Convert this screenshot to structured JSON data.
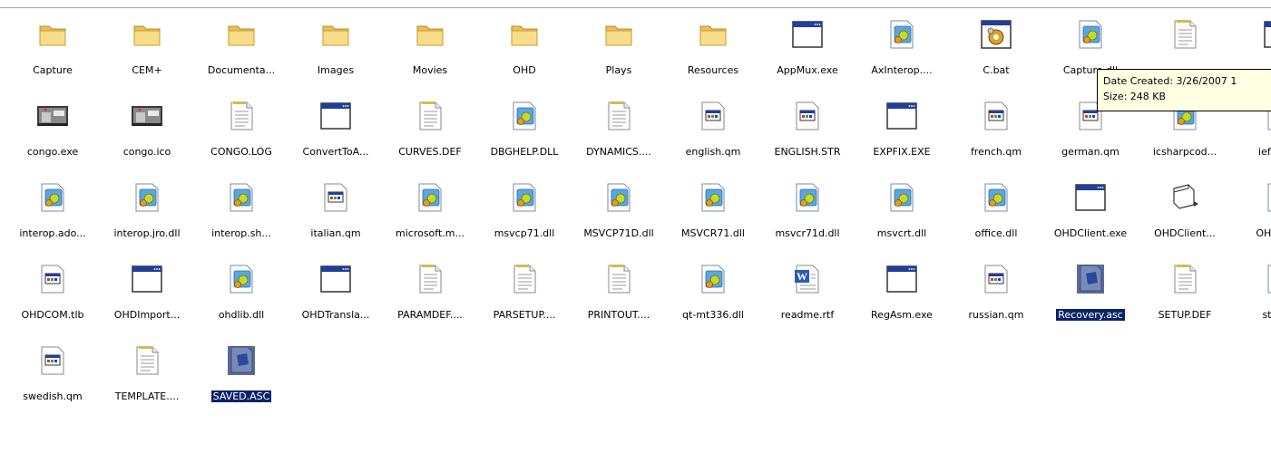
{
  "files": [
    {
      "label": "Capture",
      "icon": "folder"
    },
    {
      "label": "CEM+",
      "icon": "folder"
    },
    {
      "label": "Documenta...",
      "icon": "folder"
    },
    {
      "label": "Images",
      "icon": "folder"
    },
    {
      "label": "Movies",
      "icon": "folder"
    },
    {
      "label": "OHD",
      "icon": "folder"
    },
    {
      "label": "Plays",
      "icon": "folder"
    },
    {
      "label": "Resources",
      "icon": "folder"
    },
    {
      "label": "AppMux.exe",
      "icon": "exe"
    },
    {
      "label": "AxInterop....",
      "icon": "dll"
    },
    {
      "label": "C.bat",
      "icon": "bat"
    },
    {
      "label": "Capture.dll",
      "icon": "dll"
    },
    {
      "label": "",
      "icon": "text"
    },
    {
      "label": "",
      "icon": "exe"
    },
    {
      "label": "congo.exe",
      "icon": "photo"
    },
    {
      "label": "congo.ico",
      "icon": "photo"
    },
    {
      "label": "CONGO.LOG",
      "icon": "text"
    },
    {
      "label": "ConvertToA...",
      "icon": "exe"
    },
    {
      "label": "CURVES.DEF",
      "icon": "text"
    },
    {
      "label": "DBGHELP.DLL",
      "icon": "dll"
    },
    {
      "label": "DYNAMICS....",
      "icon": "text"
    },
    {
      "label": "english.qm",
      "icon": "qm"
    },
    {
      "label": "ENGLISH.STR",
      "icon": "qm"
    },
    {
      "label": "EXPFIX.EXE",
      "icon": "exe"
    },
    {
      "label": "french.qm",
      "icon": "qm"
    },
    {
      "label": "german.qm",
      "icon": "qm"
    },
    {
      "label": "icsharpcod...",
      "icon": "dll"
    },
    {
      "label": "ieframe.",
      "icon": "dll"
    },
    {
      "label": "interop.ado...",
      "icon": "dll"
    },
    {
      "label": "interop.jro.dll",
      "icon": "dll"
    },
    {
      "label": "interop.sh...",
      "icon": "dll"
    },
    {
      "label": "italian.qm",
      "icon": "qm"
    },
    {
      "label": "microsoft.m...",
      "icon": "dll"
    },
    {
      "label": "msvcp71.dll",
      "icon": "dll"
    },
    {
      "label": "MSVCP71D.dll",
      "icon": "dll"
    },
    {
      "label": "MSVCR71.dll",
      "icon": "dll"
    },
    {
      "label": "msvcr71d.dll",
      "icon": "dll"
    },
    {
      "label": "msvcrt.dll",
      "icon": "dll"
    },
    {
      "label": "office.dll",
      "icon": "dll"
    },
    {
      "label": "OHDClient.exe",
      "icon": "exe"
    },
    {
      "label": "OHDClient...",
      "icon": "config"
    },
    {
      "label": "OHDCOM",
      "icon": "dll"
    },
    {
      "label": "OHDCOM.tlb",
      "icon": "qm"
    },
    {
      "label": "OHDImport...",
      "icon": "exe"
    },
    {
      "label": "ohdlib.dll",
      "icon": "dll"
    },
    {
      "label": "OHDTransla...",
      "icon": "exe"
    },
    {
      "label": "PARAMDEF....",
      "icon": "text"
    },
    {
      "label": "PARSETUP....",
      "icon": "text"
    },
    {
      "label": "PRINTOUT....",
      "icon": "text"
    },
    {
      "label": "qt-mt336.dll",
      "icon": "dll"
    },
    {
      "label": "readme.rtf",
      "icon": "word"
    },
    {
      "label": "RegAsm.exe",
      "icon": "exe"
    },
    {
      "label": "russian.qm",
      "icon": "qm"
    },
    {
      "label": "Recovery.asc",
      "icon": "asc",
      "selected": true
    },
    {
      "label": "SETUP.DEF",
      "icon": "text"
    },
    {
      "label": "stdole.",
      "icon": "dll"
    },
    {
      "label": "swedish.qm",
      "icon": "qm"
    },
    {
      "label": "TEMPLATE....",
      "icon": "text"
    },
    {
      "label": "SAVED.ASC",
      "icon": "asc",
      "selected": true
    }
  ],
  "tooltip": {
    "line1": "Date Created: 3/26/2007 1",
    "line2": "Size: 248 KB"
  },
  "colors": {
    "folder": "#f4d77a",
    "selection": "#0a246a",
    "tooltip_bg": "#ffffe1"
  }
}
